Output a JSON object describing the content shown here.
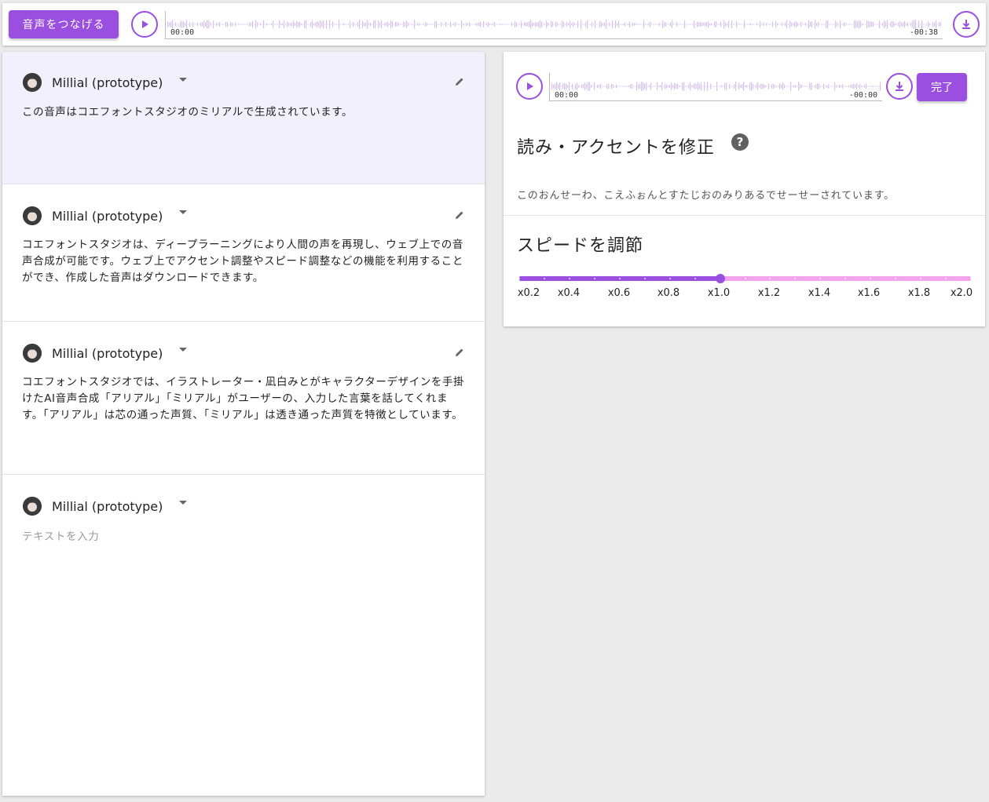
{
  "topbar": {
    "join_label": "音声をつなげる",
    "time_start": "00:00",
    "time_end": "-00:38"
  },
  "blocks": [
    {
      "speaker": "Millial (prototype)",
      "text": "この音声はコエフォントスタジオのミリアルで生成されています。"
    },
    {
      "speaker": "Millial (prototype)",
      "text": "コエフォントスタジオは、ディープラーニングにより人間の声を再現し、ウェブ上での音声合成が可能です。ウェブ上でアクセント調整やスピード調整などの機能を利用することができ、作成した音声はダウンロードできます。"
    },
    {
      "speaker": "Millial (prototype)",
      "text": "コエフォントスタジオでは、イラストレーター・凪白みとがキャラクターデザインを手掛けたAI音声合成「アリアル」「ミリアル」がユーザーの、入力した言葉を話してくれます。「アリアル」は芯の通った声質、「ミリアル」は透き通った声質を特徴としています。"
    },
    {
      "speaker": "Millial (prototype)",
      "placeholder": "テキストを入力"
    }
  ],
  "editor": {
    "time_start": "00:00",
    "time_end": "-00:00",
    "done_label": "完了",
    "accent_title": "読み・アクセントを修正",
    "help_glyph": "?",
    "reading": "このおんせーわ、こえふぉんとすたじおのみりあるでせーせーされています。",
    "speed_title": "スピードを調節",
    "speed": {
      "min": 0.2,
      "max": 2.0,
      "value": 1.0,
      "labels": [
        "x0.2",
        "x0.4",
        "x0.6",
        "x0.8",
        "x1.0",
        "x1.2",
        "x1.4",
        "x1.6",
        "x1.8",
        "x2.0"
      ]
    }
  },
  "colors": {
    "accent": "#9a4fe0",
    "track": "#f3a3ee",
    "selected_block": "#f3f0fd"
  }
}
